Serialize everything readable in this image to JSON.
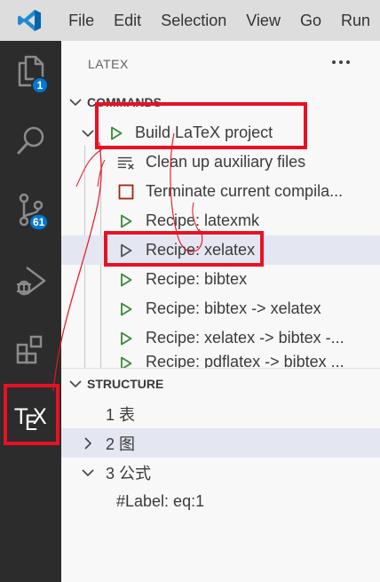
{
  "menubar": {
    "items": [
      "File",
      "Edit",
      "Selection",
      "View",
      "Go",
      "Run"
    ]
  },
  "activitybar": {
    "explorer_badge": "1",
    "scm_badge": "61",
    "tex_label": {
      "t": "T",
      "e": "E",
      "x": "X"
    },
    "icons": [
      "files-icon",
      "search-icon",
      "source-control-icon",
      "run-debug-icon",
      "extensions-icon",
      "tex-icon"
    ]
  },
  "sidebar": {
    "title": "LATEX",
    "more": "···",
    "commands": {
      "header": "COMMANDS",
      "build": "Build LaTeX project",
      "items": [
        {
          "label": "Clean up auxiliary files",
          "icon": "clean-icon"
        },
        {
          "label": "Terminate current compila...",
          "icon": "stop-icon"
        },
        {
          "label": "Recipe: latexmk",
          "icon": "play-icon"
        },
        {
          "label": "Recipe: xelatex",
          "icon": "play-icon"
        },
        {
          "label": "Recipe: bibtex",
          "icon": "play-icon"
        },
        {
          "label": "Recipe: bibtex -> xelatex",
          "icon": "play-icon"
        },
        {
          "label": "Recipe: xelatex -> bibtex -...",
          "icon": "play-icon"
        },
        {
          "label": "Recipe: pdflatex -> bibtex ...",
          "icon": "play-icon"
        }
      ]
    },
    "structure": {
      "header": "STRUCTURE",
      "items": [
        {
          "label": "1 表"
        },
        {
          "label": "2 图"
        },
        {
          "label": "3 公式"
        },
        {
          "label": "#Label: eq:1"
        }
      ]
    }
  },
  "colors": {
    "accent_play": "#388a34",
    "stop": "#a1260d",
    "badge": "#0078d4",
    "annotation": "#e81123",
    "activitybar_bg": "#2c2c2c",
    "menubar_bg": "#dddddd"
  }
}
